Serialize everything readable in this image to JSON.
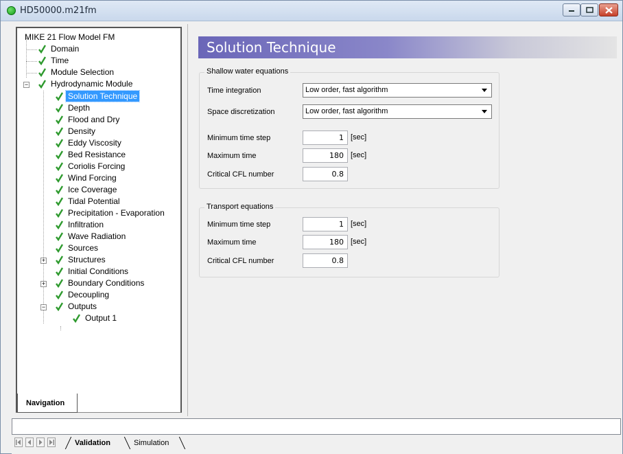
{
  "window": {
    "title": "HD50000.m21fm"
  },
  "navigation": {
    "tab_label": "Navigation",
    "tree": [
      {
        "label": "MIKE 21 Flow Model FM",
        "checked": false
      },
      {
        "label": "Domain",
        "checked": true
      },
      {
        "label": "Time",
        "checked": true
      },
      {
        "label": "Module Selection",
        "checked": true
      },
      {
        "label": "Hydrodynamic Module",
        "checked": true,
        "expanded": true
      },
      {
        "label": "Solution Technique",
        "checked": true,
        "selected": true
      },
      {
        "label": "Depth",
        "checked": true
      },
      {
        "label": "Flood and Dry",
        "checked": true
      },
      {
        "label": "Density",
        "checked": true
      },
      {
        "label": "Eddy Viscosity",
        "checked": true
      },
      {
        "label": "Bed Resistance",
        "checked": true
      },
      {
        "label": "Coriolis Forcing",
        "checked": true
      },
      {
        "label": "Wind Forcing",
        "checked": true
      },
      {
        "label": "Ice Coverage",
        "checked": true
      },
      {
        "label": "Tidal Potential",
        "checked": true
      },
      {
        "label": "Precipitation - Evaporation",
        "checked": true
      },
      {
        "label": "Infiltration",
        "checked": true
      },
      {
        "label": "Wave Radiation",
        "checked": true
      },
      {
        "label": "Sources",
        "checked": true
      },
      {
        "label": "Structures",
        "checked": true,
        "expanded": false
      },
      {
        "label": "Initial Conditions",
        "checked": true
      },
      {
        "label": "Boundary Conditions",
        "checked": true,
        "expanded": false
      },
      {
        "label": "Decoupling",
        "checked": true
      },
      {
        "label": "Outputs",
        "checked": true,
        "expanded": true
      },
      {
        "label": "Output 1",
        "checked": true
      }
    ]
  },
  "main": {
    "title": "Solution Technique",
    "shallow_water": {
      "group_title": "Shallow water equations",
      "time_integration_label": "Time integration",
      "time_integration_value": "Low order, fast algorithm",
      "space_discretization_label": "Space discretization",
      "space_discretization_value": "Low order, fast algorithm",
      "min_time_step_label": "Minimum time step",
      "min_time_step_value": "1",
      "min_time_step_unit": "[sec]",
      "max_time_label": "Maximum time",
      "max_time_value": "180",
      "max_time_unit": "[sec]",
      "cfl_label": "Critical CFL number",
      "cfl_value": "0.8"
    },
    "transport": {
      "group_title": "Transport equations",
      "min_time_step_label": "Minimum time step",
      "min_time_step_value": "1",
      "min_time_step_unit": "[sec]",
      "max_time_label": "Maximum time",
      "max_time_value": "180",
      "max_time_unit": "[sec]",
      "cfl_label": "Critical CFL number",
      "cfl_value": "0.8"
    }
  },
  "bottom": {
    "tab_validation": "Validation",
    "tab_simulation": "Simulation"
  },
  "colors": {
    "accent": "#3399ff",
    "header_gradient_start": "#6a66b8",
    "check_green": "#2e9a2e"
  }
}
